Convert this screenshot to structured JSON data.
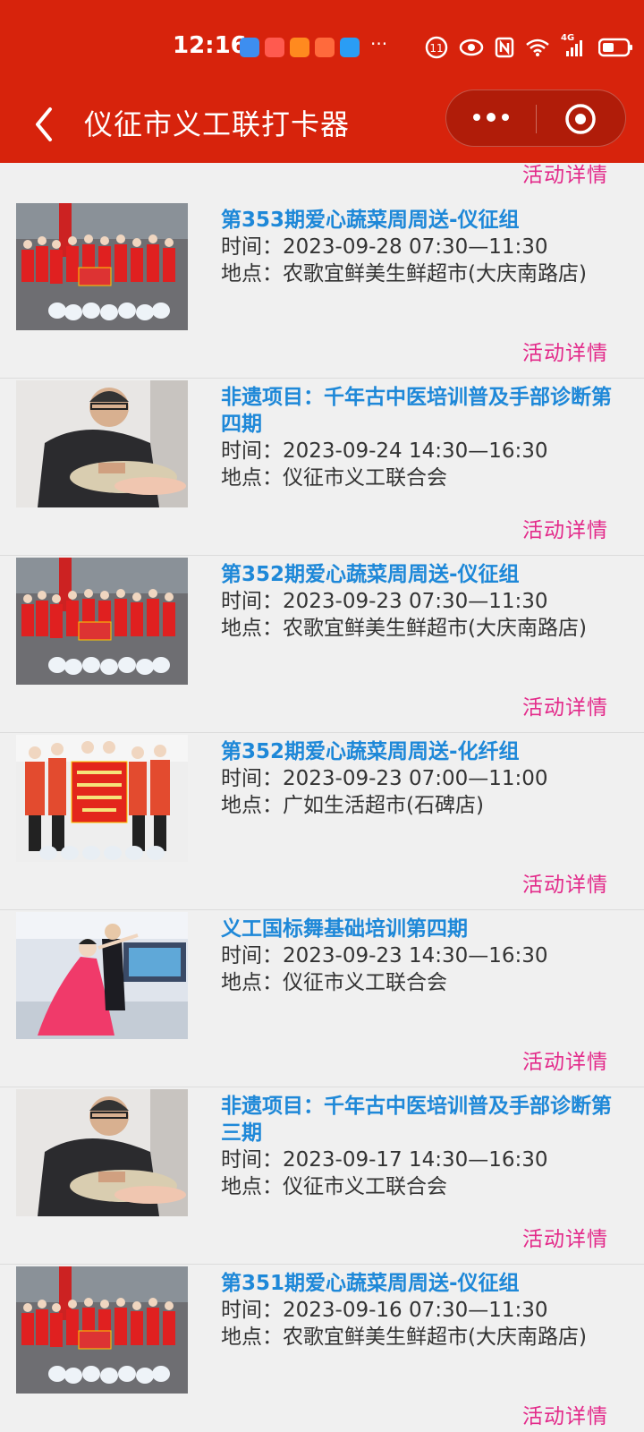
{
  "status_bar": {
    "time": "12:16",
    "network": "4G"
  },
  "nav": {
    "title": "仪征市义工联打卡器"
  },
  "list": {
    "detail_label": "活动详情",
    "items": [
      {
        "title": "第353期爱心蔬菜周周送-仪征组",
        "time": "时间：2023-09-28 07:30—11:30",
        "location": "地点：农歌宜鲜美生鲜超市(大庆南路店)",
        "image": "volunteer-group-photo"
      },
      {
        "title": "非遗项目：千年古中医培训普及手部诊断第四期",
        "time": "时间：2023-09-24 14:30—16:30",
        "location": "地点：仪征市义工联合会",
        "image": "hand-diagnosis-photo"
      },
      {
        "title": "第352期爱心蔬菜周周送-仪征组",
        "time": "时间：2023-09-23 07:30—11:30",
        "location": "地点：农歌宜鲜美生鲜超市(大庆南路店)",
        "image": "volunteer-group-photo"
      },
      {
        "title": "第352期爱心蔬菜周周送-化纤组",
        "time": "时间：2023-09-23 07:00—11:00",
        "location": "地点：广如生活超市(石碑店)",
        "image": "volunteer-banner-photo"
      },
      {
        "title": "义工国标舞基础培训第四期",
        "time": "时间：2023-09-23 14:30—16:30",
        "location": "地点：仪征市义工联合会",
        "image": "ballroom-dance-photo"
      },
      {
        "title": "非遗项目：千年古中医培训普及手部诊断第三期",
        "time": "时间：2023-09-17 14:30—16:30",
        "location": "地点：仪征市义工联合会",
        "image": "hand-diagnosis-photo"
      },
      {
        "title": "第351期爱心蔬菜周周送-仪征组",
        "time": "时间：2023-09-16 07:30—11:30",
        "location": "地点：农歌宜鲜美生鲜超市(大庆南路店)",
        "image": "volunteer-group-photo"
      }
    ]
  },
  "colors": {
    "header": "#d7230c",
    "title_blue": "#1e88d8",
    "link_pink": "#e32a8a"
  }
}
